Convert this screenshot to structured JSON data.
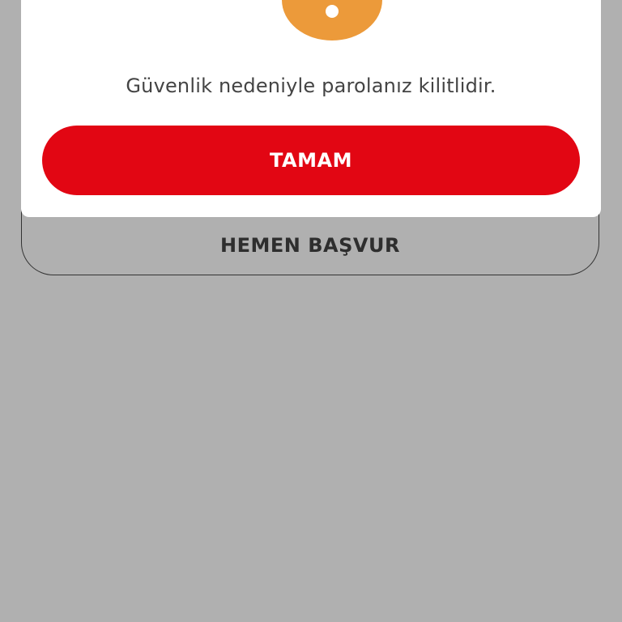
{
  "dialog": {
    "icon": "alert-icon",
    "message": "Güvenlik nedeniyle parolanız kilitlidir.",
    "ok_label": "TAMAM"
  },
  "background": {
    "apply_label": "HEMEN BAŞVUR"
  },
  "colors": {
    "overlay": "#b0b0b0",
    "accent": "#e20613",
    "warning": "#ec9a3a"
  }
}
